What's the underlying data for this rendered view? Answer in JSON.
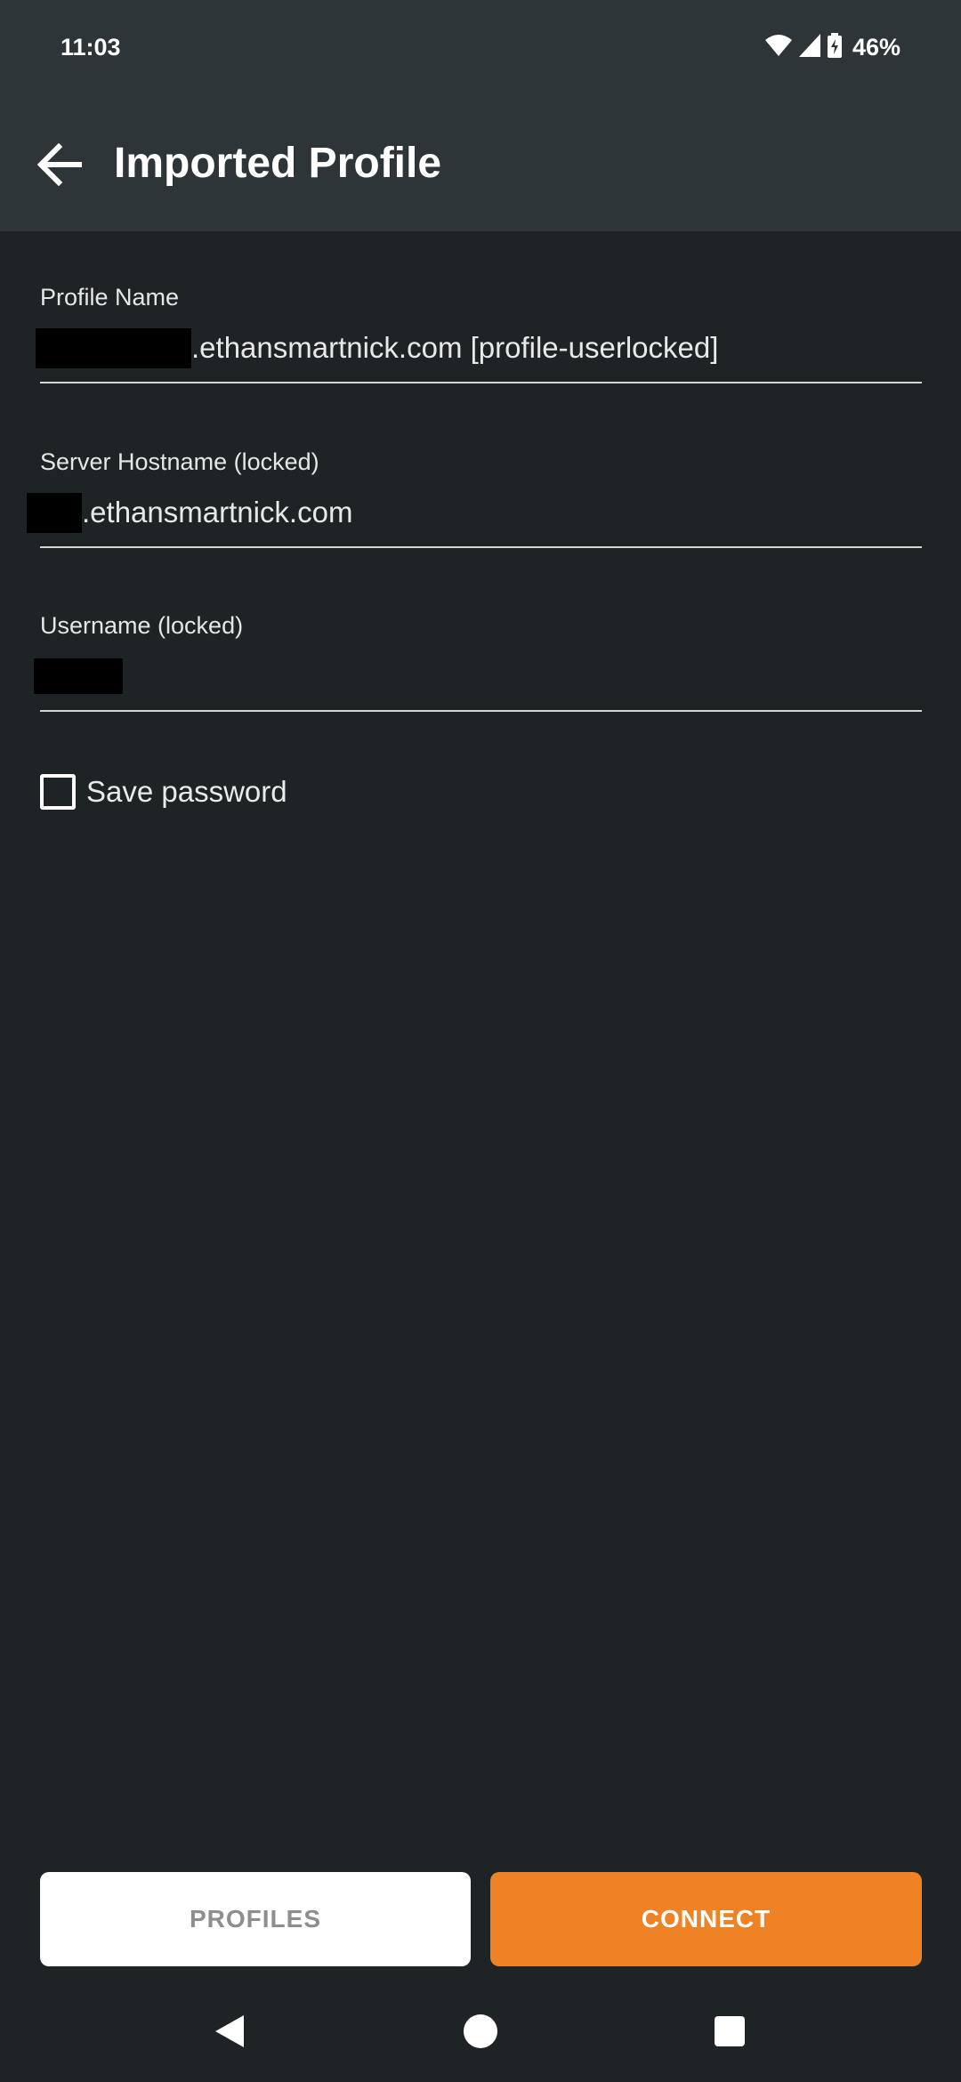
{
  "status_bar": {
    "time": "11:03",
    "battery": "46%",
    "icons": [
      "wifi-icon",
      "cell-signal-icon",
      "battery-charging-icon"
    ]
  },
  "app_bar": {
    "title": "Imported Profile",
    "back_icon": "arrow-left-icon"
  },
  "form": {
    "profile_name": {
      "label": "Profile Name",
      "value": ".ethansmartnick.com [profile-userlocked]"
    },
    "server_hostname": {
      "label": "Server Hostname (locked)",
      "value": ".ethansmartnick.com"
    },
    "username": {
      "label": "Username (locked)",
      "value": ""
    },
    "save_password": {
      "label": "Save password",
      "checked": false
    }
  },
  "buttons": {
    "profiles": "PROFILES",
    "connect": "CONNECT"
  },
  "colors": {
    "background": "#1e2426",
    "app_bar": "#2e3538",
    "accent": "#ee8224",
    "secondary_button": "#ffffff"
  },
  "nav_bar": {
    "icons": [
      "back-triangle-icon",
      "home-circle-icon",
      "recents-square-icon"
    ]
  }
}
